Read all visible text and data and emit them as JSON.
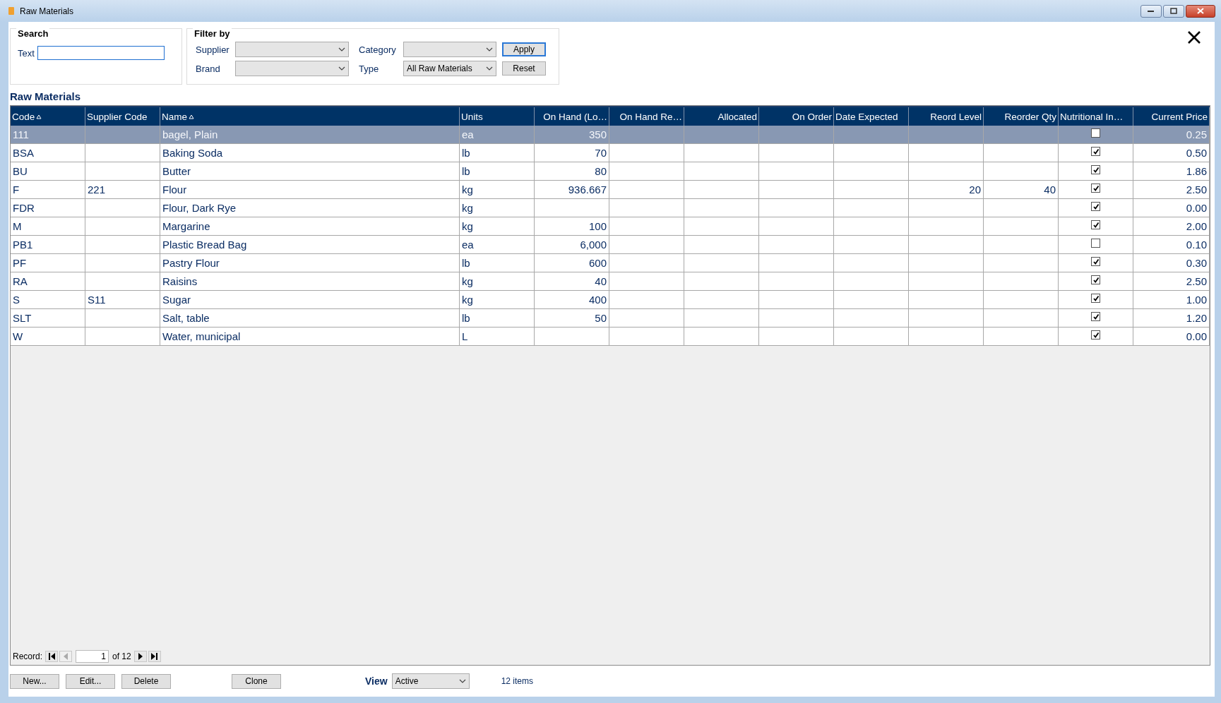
{
  "window": {
    "title": "Raw Materials"
  },
  "search": {
    "title": "Search",
    "field": {
      "label": "Text",
      "focused": true
    }
  },
  "filter": {
    "title": "Filter by",
    "dropdowns": [
      {
        "label": "Supplier"
      },
      {
        "label": "Category"
      },
      {
        "label": "Brand"
      },
      {
        "label": "Type",
        "value": "All Raw Materials"
      }
    ],
    "buttons": [
      {
        "label": "Apply",
        "focused": true
      },
      {
        "label": "Reset",
        "focused": false
      }
    ]
  },
  "grid": {
    "title": "Raw Materials",
    "columns": [
      {
        "label": "Code",
        "kind": "text",
        "sorted": true
      },
      {
        "label": "Supplier Code",
        "kind": "text",
        "sorted": false
      },
      {
        "label": "Name",
        "kind": "text",
        "sorted": true
      },
      {
        "label": "Units",
        "kind": "text",
        "sorted": false
      },
      {
        "label": "On Hand (Lo…",
        "kind": "number",
        "sorted": false
      },
      {
        "label": "On Hand Re…",
        "kind": "number",
        "sorted": false
      },
      {
        "label": "Allocated",
        "kind": "number",
        "sorted": false
      },
      {
        "label": "On Order",
        "kind": "number",
        "sorted": false
      },
      {
        "label": "Date Expected",
        "kind": "text",
        "sorted": false
      },
      {
        "label": "Reord Level",
        "kind": "number",
        "sorted": false
      },
      {
        "label": "Reorder Qty",
        "kind": "number",
        "sorted": false
      },
      {
        "label": "Nutritional In…",
        "kind": "check",
        "sorted": false
      },
      {
        "label": "Current Price",
        "kind": "number",
        "sorted": false
      }
    ],
    "rows": [
      {
        "selected": true,
        "checked": false,
        "cells": [
          "111",
          null,
          "bagel, Plain",
          "ea",
          "350",
          null,
          null,
          null,
          null,
          null,
          null,
          null,
          "0.25"
        ]
      },
      {
        "selected": false,
        "checked": true,
        "cells": [
          "BSA",
          null,
          "Baking Soda",
          "lb",
          "70",
          null,
          null,
          null,
          null,
          null,
          null,
          null,
          "0.50"
        ]
      },
      {
        "selected": false,
        "checked": true,
        "cells": [
          "BU",
          null,
          "Butter",
          "lb",
          "80",
          null,
          null,
          null,
          null,
          null,
          null,
          null,
          "1.86"
        ]
      },
      {
        "selected": false,
        "checked": true,
        "cells": [
          "F",
          "221",
          "Flour",
          "kg",
          "936.667",
          null,
          null,
          null,
          null,
          "20",
          "40",
          null,
          "2.50"
        ]
      },
      {
        "selected": false,
        "checked": true,
        "cells": [
          "FDR",
          null,
          "Flour, Dark Rye",
          "kg",
          null,
          null,
          null,
          null,
          null,
          null,
          null,
          null,
          "0.00"
        ]
      },
      {
        "selected": false,
        "checked": true,
        "cells": [
          "M",
          null,
          "Margarine",
          "kg",
          "100",
          null,
          null,
          null,
          null,
          null,
          null,
          null,
          "2.00"
        ]
      },
      {
        "selected": false,
        "checked": false,
        "cells": [
          "PB1",
          null,
          "Plastic Bread Bag",
          "ea",
          "6,000",
          null,
          null,
          null,
          null,
          null,
          null,
          null,
          "0.10"
        ]
      },
      {
        "selected": false,
        "checked": true,
        "cells": [
          "PF",
          null,
          "Pastry Flour",
          "lb",
          "600",
          null,
          null,
          null,
          null,
          null,
          null,
          null,
          "0.30"
        ]
      },
      {
        "selected": false,
        "checked": true,
        "cells": [
          "RA",
          null,
          "Raisins",
          "kg",
          "40",
          null,
          null,
          null,
          null,
          null,
          null,
          null,
          "2.50"
        ]
      },
      {
        "selected": false,
        "checked": true,
        "cells": [
          "S",
          "S11",
          "Sugar",
          "kg",
          "400",
          null,
          null,
          null,
          null,
          null,
          null,
          null,
          "1.00"
        ]
      },
      {
        "selected": false,
        "checked": true,
        "cells": [
          "SLT",
          null,
          "Salt, table",
          "lb",
          "50",
          null,
          null,
          null,
          null,
          null,
          null,
          null,
          "1.20"
        ]
      },
      {
        "selected": false,
        "checked": true,
        "cells": [
          "W",
          null,
          "Water, municipal",
          "L",
          null,
          null,
          null,
          null,
          null,
          null,
          null,
          null,
          "0.00"
        ]
      }
    ],
    "navigator": {
      "label": "Record:",
      "current": "1",
      "total": "of 12",
      "prev_disabled": true
    }
  },
  "buttons": [
    {
      "label": "New..."
    },
    {
      "label": "Edit..."
    },
    {
      "label": "Delete"
    },
    {
      "label": "Clone"
    }
  ],
  "view": {
    "label": "View",
    "value": "Active"
  },
  "count": "12 items"
}
